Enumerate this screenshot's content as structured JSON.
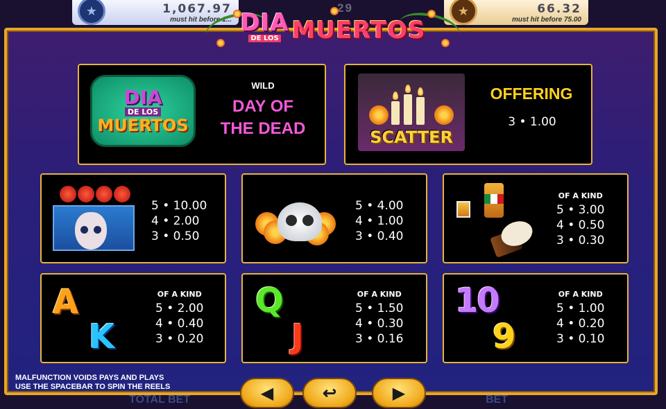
{
  "jackpots": {
    "left_amount": "1,067.97",
    "left_note": "must hit before 1...",
    "mid_amount": "29",
    "right_amount": "66.32",
    "right_note": "must hit before 75.00"
  },
  "title": {
    "dia": "DIA",
    "de_los": "DE LOS",
    "muertos": "MUERTOS"
  },
  "wild": {
    "logo_dia": "DIA",
    "logo_de_los": "DE LOS",
    "logo_muertos": "MUERTOS",
    "tag": "WILD",
    "name_line1": "DAY OF",
    "name_line2": "THE DEAD"
  },
  "scatter": {
    "label": "SCATTER",
    "name": "OFFERING",
    "pay": "3 • 1.00"
  },
  "paytable": {
    "catrina": [
      "5 • 10.00",
      "4 • 2.00",
      "3 • 0.50"
    ],
    "skull": [
      "5 • 4.00",
      "4 • 1.00",
      "3 • 0.40"
    ],
    "tequila_drum": {
      "kind": "OF A KIND",
      "rows": [
        "5 • 3.00",
        "4 • 0.50",
        "3 • 0.30"
      ]
    },
    "a_k": {
      "kind": "OF A KIND",
      "glyph1": "A",
      "glyph2": "K",
      "rows": [
        "5 • 2.00",
        "4 • 0.40",
        "3 • 0.20"
      ]
    },
    "q_j": {
      "kind": "OF A KIND",
      "glyph1": "Q",
      "glyph2": "J",
      "rows": [
        "5 • 1.50",
        "4 • 0.30",
        "3 • 0.16"
      ]
    },
    "ten_nine": {
      "kind": "OF A KIND",
      "glyph1": "10",
      "glyph2": "9",
      "rows": [
        "5 • 1.00",
        "4 • 0.20",
        "3 • 0.10"
      ]
    }
  },
  "footer": {
    "line1": "MALFUNCTION VOIDS PAYS AND PLAYS",
    "line2": "USE THE SPACEBAR TO SPIN THE REELS",
    "prev_icon": "◀",
    "back_icon": "↩",
    "next_icon": "▶",
    "behind_left": "TOTAL BET",
    "behind_right": "BET"
  },
  "colors": {
    "frame_border": "#e7a62a",
    "panel_border": "#e9b43a",
    "wild_name": "#f25ad8",
    "offering": "#ffd21a"
  },
  "icons": {
    "left_jackpot": "star-icon",
    "right_jackpot": "star-icon",
    "prev": "arrow-left-icon",
    "back": "return-icon",
    "next": "arrow-right-icon"
  }
}
